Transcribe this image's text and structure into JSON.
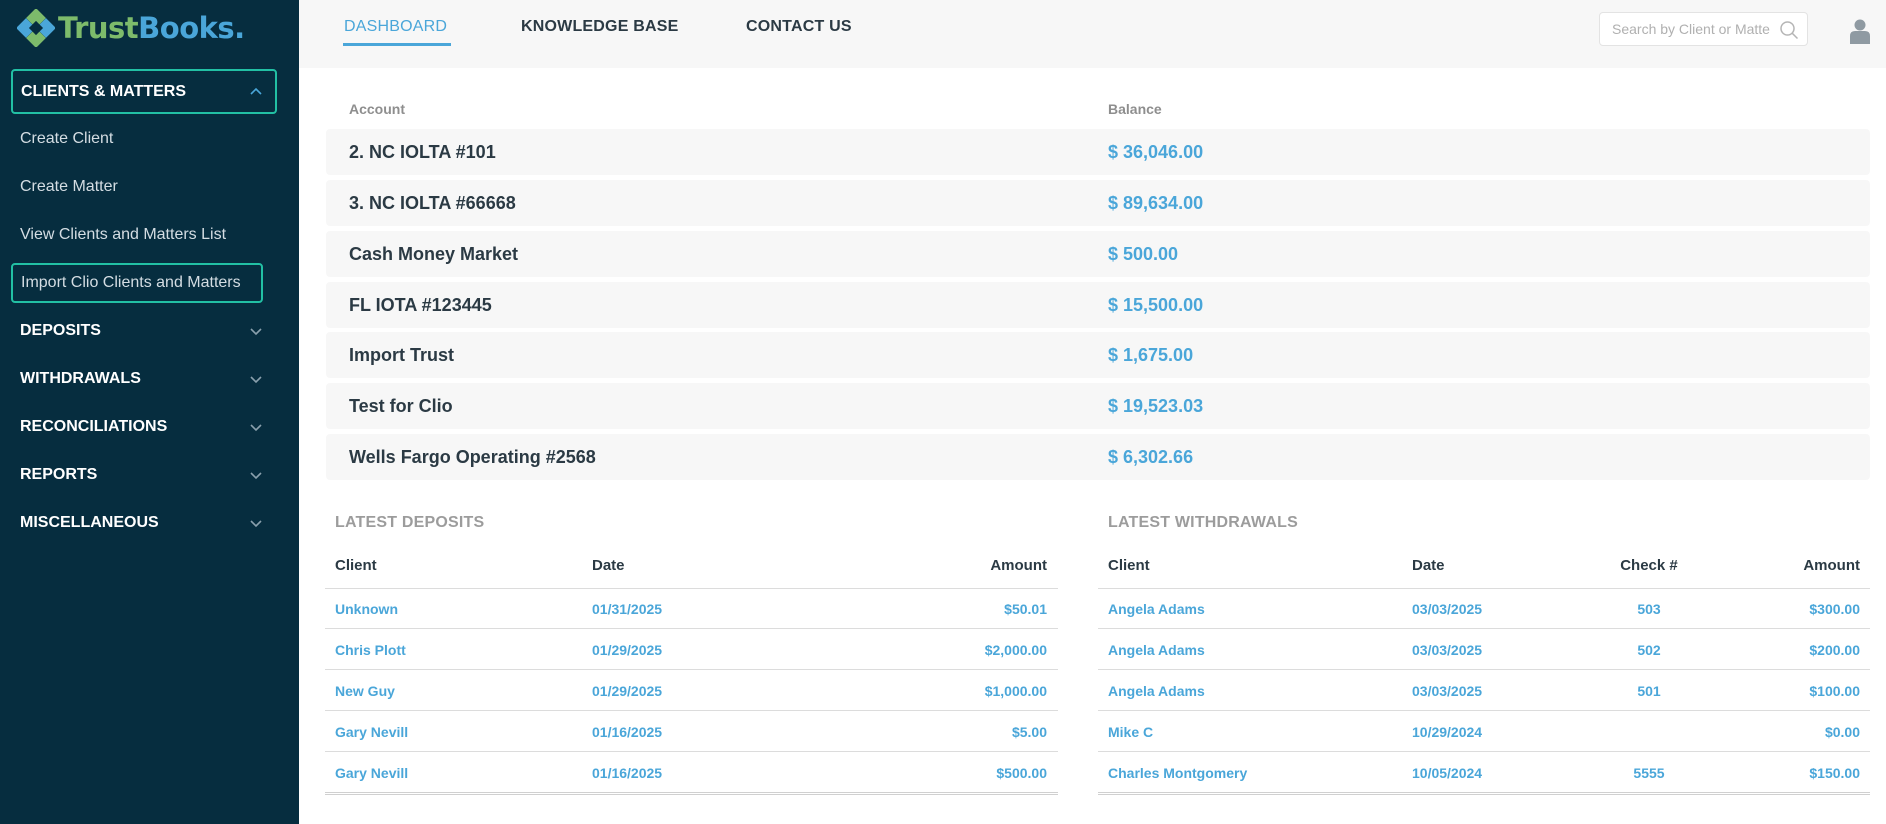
{
  "brand": {
    "name_part1": "Trust",
    "name_part2": "Books",
    "name_suffix": "."
  },
  "sidebar": {
    "sections": [
      {
        "label": "CLIENTS & MATTERS",
        "expanded": true,
        "items": [
          {
            "label": "Create Client"
          },
          {
            "label": "Create Matter"
          },
          {
            "label": "View Clients and Matters List"
          },
          {
            "label": "Import Clio Clients and Matters"
          }
        ]
      },
      {
        "label": "DEPOSITS"
      },
      {
        "label": "WITHDRAWALS"
      },
      {
        "label": "RECONCILIATIONS"
      },
      {
        "label": "REPORTS"
      },
      {
        "label": "MISCELLANEOUS"
      }
    ]
  },
  "topnav": {
    "tabs": [
      {
        "label": "DASHBOARD",
        "active": true
      },
      {
        "label": "KNOWLEDGE BASE"
      },
      {
        "label": "CONTACT US"
      }
    ],
    "search_placeholder": "Search by Client or Matter"
  },
  "accounts": {
    "col_account": "Account",
    "col_balance": "Balance",
    "rows": [
      {
        "name": "2. NC IOLTA #101",
        "balance": "$ 36,046.00"
      },
      {
        "name": "3. NC IOLTA #66668",
        "balance": "$ 89,634.00"
      },
      {
        "name": "Cash Money Market",
        "balance": "$ 500.00"
      },
      {
        "name": "FL IOTA #123445",
        "balance": "$ 15,500.00"
      },
      {
        "name": "Import Trust",
        "balance": "$ 1,675.00"
      },
      {
        "name": "Test for Clio",
        "balance": "$ 19,523.03"
      },
      {
        "name": "Wells Fargo Operating #2568",
        "balance": "$ 6,302.66"
      }
    ]
  },
  "latest_deposits": {
    "title": "LATEST DEPOSITS",
    "headers": {
      "client": "Client",
      "date": "Date",
      "amount": "Amount"
    },
    "rows": [
      {
        "client": "Unknown",
        "date": "01/31/2025",
        "amount": "$50.01"
      },
      {
        "client": "Chris Plott",
        "date": "01/29/2025",
        "amount": "$2,000.00"
      },
      {
        "client": "New Guy",
        "date": "01/29/2025",
        "amount": "$1,000.00"
      },
      {
        "client": "Gary Nevill",
        "date": "01/16/2025",
        "amount": "$5.00"
      },
      {
        "client": "Gary Nevill",
        "date": "01/16/2025",
        "amount": "$500.00"
      }
    ]
  },
  "latest_withdrawals": {
    "title": "LATEST WITHDRAWALS",
    "headers": {
      "client": "Client",
      "date": "Date",
      "check": "Check #",
      "amount": "Amount"
    },
    "rows": [
      {
        "client": "Angela Adams",
        "date": "03/03/2025",
        "check": "503",
        "amount": "$300.00"
      },
      {
        "client": "Angela Adams",
        "date": "03/03/2025",
        "check": "502",
        "amount": "$200.00"
      },
      {
        "client": "Angela Adams",
        "date": "03/03/2025",
        "check": "501",
        "amount": "$100.00"
      },
      {
        "client": "Mike C",
        "date": "10/29/2024",
        "check": "",
        "amount": "$0.00"
      },
      {
        "client": "Charles Montgomery",
        "date": "10/05/2024",
        "check": "5555",
        "amount": "$150.00"
      }
    ]
  },
  "colors": {
    "sidebar_bg": "#062d3f",
    "accent_blue": "#4aa6d9",
    "accent_green": "#7dbb6b",
    "highlight_border": "#22c0a4"
  },
  "icons": {
    "logo": "diamond-logo-icon",
    "chevron_up": "chevron-up-icon",
    "chevron_down": "chevron-down-icon",
    "search": "search-icon",
    "user": "user-icon"
  }
}
